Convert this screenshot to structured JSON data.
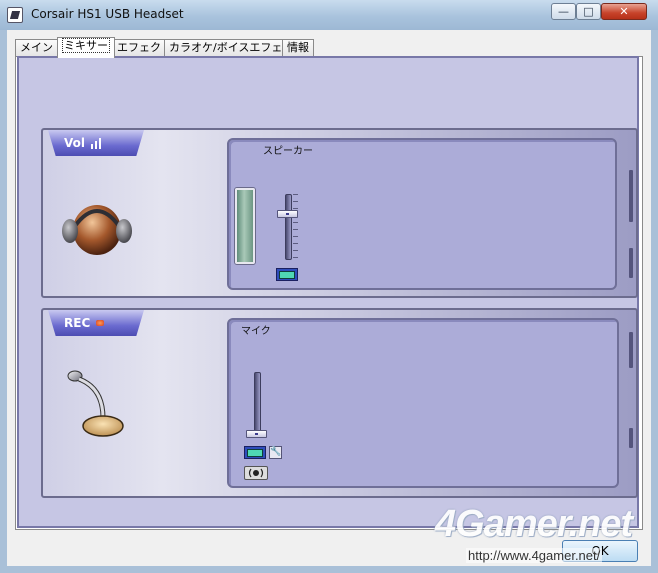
{
  "window": {
    "title": "Corsair HS1 USB Headset",
    "minimize_label": "—",
    "maximize_label": "□",
    "close_label": "✕"
  },
  "tabs": [
    {
      "label": "メイン",
      "active": false
    },
    {
      "label": "ミキサー",
      "active": true
    },
    {
      "label": "エフェクト",
      "active": false
    },
    {
      "label": "カラオケ/ボイスエフェクト",
      "active": false
    },
    {
      "label": "情報",
      "active": false
    }
  ],
  "mixer": {
    "playback": {
      "tag": "Vol",
      "icon": "headphone-icon",
      "device_label": "スピーカー",
      "volume_level": 0.72
    },
    "recording": {
      "tag": "REC",
      "icon": "microphone-icon",
      "device_label": "マイク",
      "volume_level": 0.0
    }
  },
  "footer": {
    "ok_label": "OK"
  },
  "watermark": {
    "logo": "4Gamer.net",
    "url": "http://www.4gamer.net/"
  },
  "colors": {
    "panel_background": "#acacd8",
    "tag_background": "#6b6bd0",
    "mute_button": "#4fd8b4"
  }
}
